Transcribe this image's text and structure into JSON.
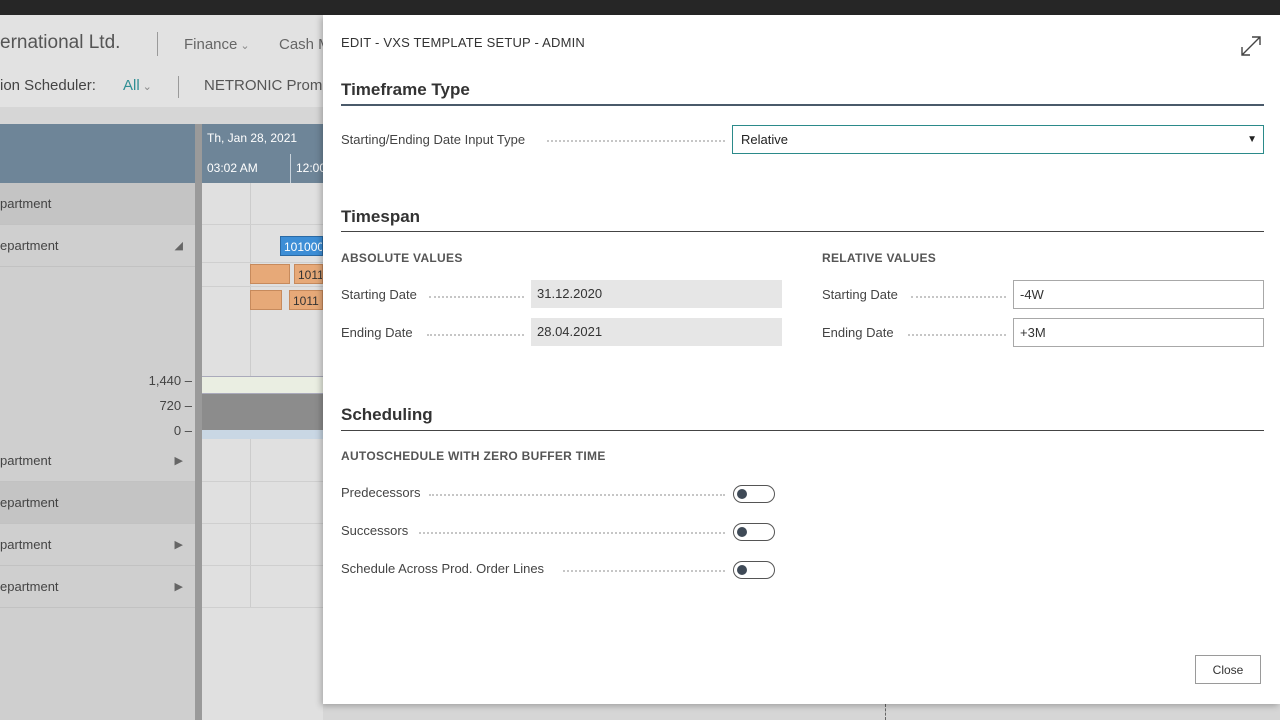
{
  "background": {
    "company_name": "ernational Ltd.",
    "nav": [
      {
        "label": "Finance"
      },
      {
        "label": "Cash M"
      }
    ],
    "scheduler_label": "ion Scheduler:",
    "scheduler_filter": "All",
    "netronic_label": "NETRONIC Prom",
    "gantt": {
      "date_header": "Th, Jan 28, 2021",
      "time_1": "03:02 AM",
      "time_2": "12:00",
      "departments": [
        {
          "label": "partment"
        },
        {
          "label": "epartment"
        },
        {
          "label": "partment"
        },
        {
          "label": "epartment"
        },
        {
          "label": "partment"
        },
        {
          "label": "epartment"
        }
      ],
      "bars": [
        {
          "label": "101000"
        },
        {
          "label": "1011"
        },
        {
          "label": "1011"
        }
      ],
      "scale": [
        "1,440",
        "720",
        "0"
      ]
    }
  },
  "dialog": {
    "title": "EDIT - VXS TEMPLATE SETUP - ADMIN",
    "timeframe": {
      "title": "Timeframe Type",
      "input_type_label": "Starting/Ending Date Input Type",
      "input_type_value": "Relative"
    },
    "timespan": {
      "title": "Timespan",
      "absolute": {
        "heading": "ABSOLUTE VALUES",
        "starting_label": "Starting Date",
        "starting_value": "31.12.2020",
        "ending_label": "Ending Date",
        "ending_value": "28.04.2021"
      },
      "relative": {
        "heading": "RELATIVE VALUES",
        "starting_label": "Starting Date",
        "starting_value": "-4W",
        "ending_label": "Ending Date",
        "ending_value": "+3M"
      }
    },
    "scheduling": {
      "title": "Scheduling",
      "subheading": "AUTOSCHEDULE WITH ZERO BUFFER TIME",
      "toggles": [
        {
          "label": "Predecessors",
          "on": false
        },
        {
          "label": "Successors",
          "on": false
        },
        {
          "label": "Schedule Across Prod. Order Lines",
          "on": false
        }
      ]
    },
    "close_label": "Close"
  }
}
